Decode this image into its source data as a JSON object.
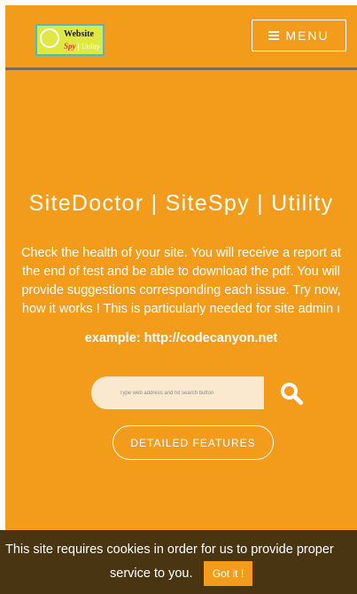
{
  "header": {
    "logo": {
      "line1": "Website",
      "line2_part1": "Spy",
      "line2_sep": "|",
      "line2_part2": "Utility"
    },
    "menu_label": "MENU"
  },
  "hero": {
    "title": "SiteDoctor | SiteSpy | Utility",
    "description": "Check the health of your site. You will receive a report at the end of test and be able to download the pdf. You will provide suggestions corresponding each issue. Try now, how it works ! This is particularly needed for site admin ı",
    "example": "example: http://codecanyon.net"
  },
  "search": {
    "placeholder": "Type web address and hit search button",
    "icon": "search-icon"
  },
  "features_button": "DETAILED FEATURES",
  "cookie_banner": {
    "line1": "This site requires cookies in order for us to provide proper",
    "line2": "service to you.",
    "button_label": "Got it !"
  },
  "colors": {
    "page_background": "#f39c1c",
    "cookie_background": "#4a3512",
    "search_field": "#fbe9cf",
    "logo_background": "#dfe843",
    "logo_border": "#39c2d7"
  }
}
